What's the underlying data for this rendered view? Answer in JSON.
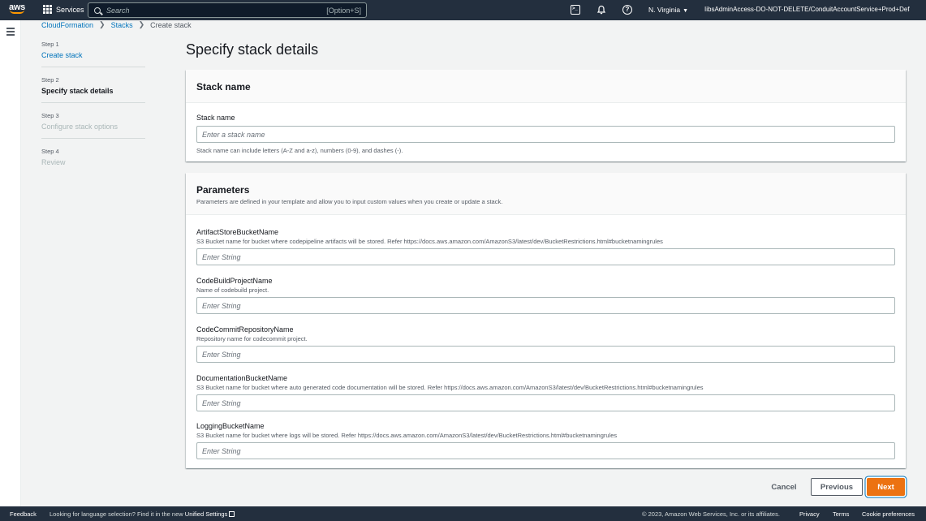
{
  "topnav": {
    "logo_text": "aws",
    "services_label": "Services",
    "search_placeholder": "Search",
    "search_shortcut": "[Option+S]",
    "region": "N. Virginia",
    "account": "IibsAdminAccess-DO-NOT-DELETE/ConduitAccountService+Prod+Defa..."
  },
  "breadcrumb": {
    "items": [
      "CloudFormation",
      "Stacks"
    ],
    "current": "Create stack"
  },
  "steps": [
    {
      "num": "Step 1",
      "label": "Create stack"
    },
    {
      "num": "Step 2",
      "label": "Specify stack details"
    },
    {
      "num": "Step 3",
      "label": "Configure stack options"
    },
    {
      "num": "Step 4",
      "label": "Review"
    }
  ],
  "page_title": "Specify stack details",
  "stack_name_panel": {
    "title": "Stack name",
    "field_label": "Stack name",
    "placeholder": "Enter a stack name",
    "value": "",
    "constraint": "Stack name can include letters (A-Z and a-z), numbers (0-9), and dashes (-)."
  },
  "parameters_panel": {
    "title": "Parameters",
    "description": "Parameters are defined in your template and allow you to input custom values when you create or update a stack.",
    "params": [
      {
        "name": "ArtifactStoreBucketName",
        "desc": "S3 Bucket name for bucket where codepipeline artifacts will be stored. Refer https://docs.aws.amazon.com/AmazonS3/latest/dev/BucketRestrictions.html#bucketnamingrules",
        "placeholder": "Enter String"
      },
      {
        "name": "CodeBuildProjectName",
        "desc": "Name of codebuild project.",
        "placeholder": "Enter String"
      },
      {
        "name": "CodeCommitRepositoryName",
        "desc": "Repository name for codecommit project.",
        "placeholder": "Enter String"
      },
      {
        "name": "DocumentationBucketName",
        "desc": "S3 Bucket name for bucket where auto generated code documentation will be stored. Refer https://docs.aws.amazon.com/AmazonS3/latest/dev/BucketRestrictions.html#bucketnamingrules",
        "placeholder": "Enter String"
      },
      {
        "name": "LoggingBucketName",
        "desc": "S3 Bucket name for bucket where logs will be stored. Refer https://docs.aws.amazon.com/AmazonS3/latest/dev/BucketRestrictions.html#bucketnamingrules",
        "placeholder": "Enter String"
      }
    ]
  },
  "actions": {
    "cancel": "Cancel",
    "previous": "Previous",
    "next": "Next"
  },
  "footer": {
    "feedback": "Feedback",
    "lang_prefix": "Looking for language selection? Find it in the new",
    "lang_link": "Unified Settings",
    "copyright": "© 2023, Amazon Web Services, Inc. or its affiliates.",
    "privacy": "Privacy",
    "terms": "Terms",
    "cookies": "Cookie preferences"
  },
  "colors": {
    "nav_bg": "#232f3e",
    "link": "#0073bb",
    "primary_button": "#ec7211",
    "logo_smile": "#ff9900"
  }
}
